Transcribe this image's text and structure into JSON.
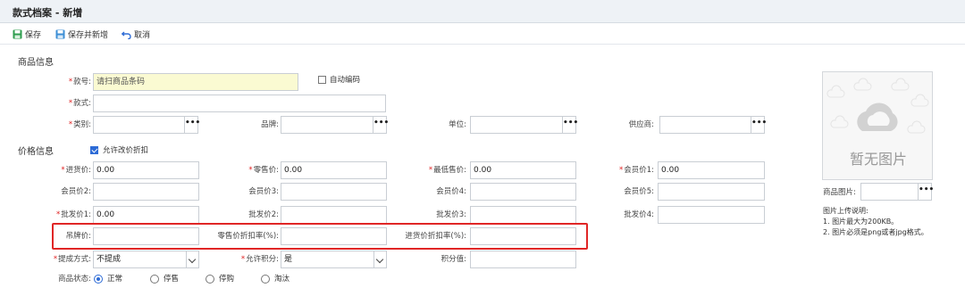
{
  "window": {
    "title": "款式档案 - 新增"
  },
  "toolbar": {
    "save_label": "保存",
    "save_new_label": "保存并新增",
    "cancel_label": "取消"
  },
  "sections": {
    "product_info": "商品信息",
    "price_info": "价格信息"
  },
  "product": {
    "code_label": "款号:",
    "code_placeholder": "请扫商品条码",
    "auto_code_label": "自动编码",
    "style_label": "款式:",
    "category_label": "类别:",
    "brand_label": "品牌:",
    "unit_label": "单位:",
    "supplier_label": "供应商:",
    "lookup_glyph": "•••"
  },
  "price": {
    "allow_discount_label": "允许改价折扣",
    "purchase_price_label": "进货价:",
    "purchase_price_value": "0.00",
    "retail_price_label": "零售价:",
    "retail_price_value": "0.00",
    "min_price_label": "最低售价:",
    "min_price_value": "0.00",
    "member1_label": "会员价1:",
    "member1_value": "0.00",
    "member2_label": "会员价2:",
    "member3_label": "会员价3:",
    "member4_label": "会员价4:",
    "member5_label": "会员价5:",
    "wholesale1_label": "批发价1:",
    "wholesale1_value": "0.00",
    "wholesale2_label": "批发价2:",
    "wholesale3_label": "批发价3:",
    "wholesale4_label": "批发价4:",
    "tag_price_label": "吊牌价:",
    "retail_discount_label": "零售价折扣率(%):",
    "purchase_discount_label": "进货价折扣率(%):",
    "commission_label": "提成方式:",
    "commission_value": "不提成",
    "allow_points_label": "允许积分:",
    "allow_points_value": "是",
    "points_label": "积分值:"
  },
  "status": {
    "label": "商品状态:",
    "options": [
      "正常",
      "停售",
      "停购",
      "淘汰"
    ],
    "selected": "正常"
  },
  "image": {
    "placeholder_text": "暂无图片",
    "field_label": "商品图片:",
    "notes_title": "图片上传说明:",
    "note1": "1. 图片最大为200KB。",
    "note2": "2. 图片必须是png或者jpg格式。"
  },
  "colors": {
    "accent": "#2d6bd6",
    "required": "#e02020",
    "highlight": "#e02626",
    "input_yellow": "#fafad2"
  }
}
